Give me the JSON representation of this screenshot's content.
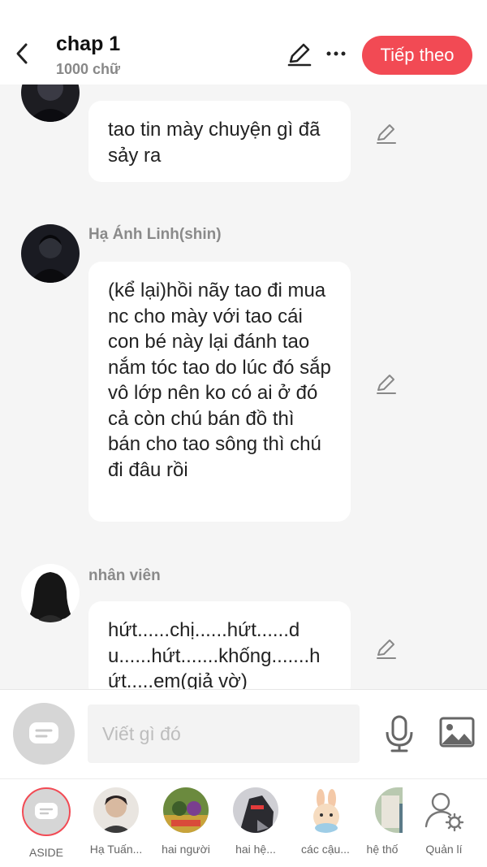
{
  "header": {
    "title": "chap 1",
    "subtitle": "1000 chữ",
    "next_label": "Tiếp theo"
  },
  "messages": [
    {
      "sender": "",
      "text": "tao tin mày chuyện gì đã sảy ra"
    },
    {
      "sender": "Hạ Ánh Linh(shin)",
      "text": "(kể lại)hồi nãy tao đi mua nc cho mày với tao cái con bé này lại đánh tao nắm tóc tao do lúc đó sắp vô lớp nên ko có ai ở đó cả còn chú bán đồ thì bán cho tao sông thì chú đi đâu rồi"
    },
    {
      "sender": "nhân viên",
      "text": "hứt......chị......hứt......du......hứt.......khống.......hứt.....em(giả vờ)"
    }
  ],
  "input": {
    "placeholder": "Viết gì đó"
  },
  "characters": [
    {
      "name": "ASIDE",
      "icon": "chat-bubble-icon"
    },
    {
      "name": "Hạ Tuấn..."
    },
    {
      "name": "hai người"
    },
    {
      "name": "hai hệ..."
    },
    {
      "name": "các cậu..."
    },
    {
      "name": "hệ thố"
    },
    {
      "name": "Quản lí",
      "icon": "user-settings-icon"
    }
  ],
  "colors": {
    "accent": "#f24a54",
    "background": "#f5f5f5",
    "bubble": "#ffffff",
    "muted_text": "#8a8a8a"
  }
}
